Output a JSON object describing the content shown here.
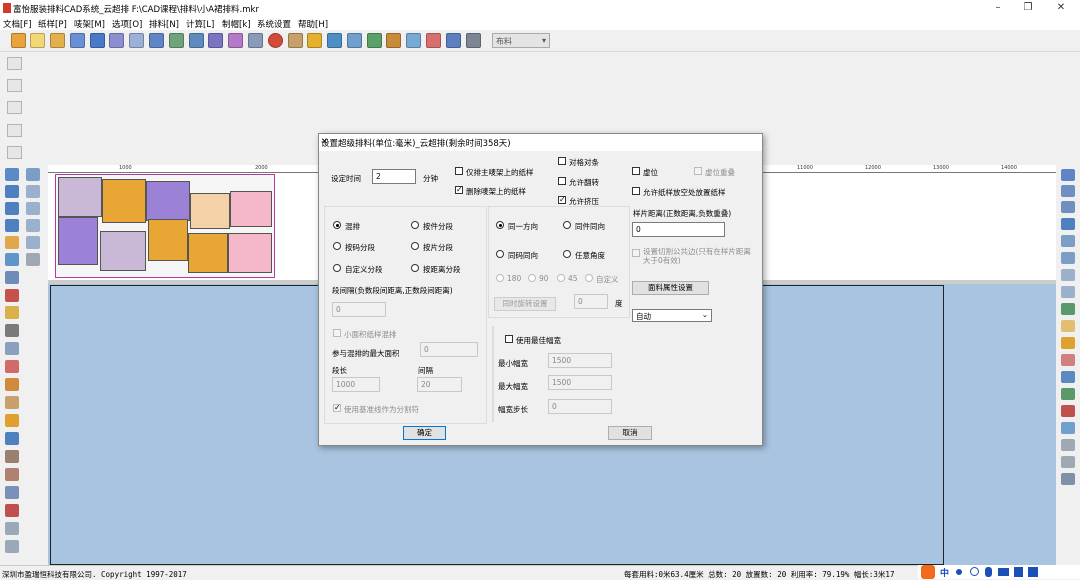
{
  "window": {
    "title": "富怡服装排料CAD系统_云超排 F:\\CAD课程\\排料\\小A裙排料.mkr"
  },
  "menu": [
    "文档[F]",
    "纸样[P]",
    "唛架[M]",
    "选项[O]",
    "排料[N]",
    "计算[L]",
    "制帽[k]",
    "系统设置",
    "帮助[H]"
  ],
  "toolbar": {
    "dropdown": "布料"
  },
  "ruler": [
    "1000",
    "2000",
    "11000",
    "12000",
    "13000",
    "14000"
  ],
  "dialog": {
    "title": "设置超级排料(单位:毫米)_云超排(剩余时间358天)",
    "set_time_label": "设定时间",
    "set_time_value": "2",
    "minute_label": "分钟",
    "opts": {
      "only_main_frame": "仅排主唛架上的纸样",
      "delete_frame": "删除唛架上的纸样",
      "strict_align": "对格对条",
      "allow_flip": "允许翻转",
      "allow_overlap": "允许挤压",
      "virtual": "虚位",
      "virtual_overlap": "虚位重叠",
      "allow_other_pos": "允许纸样放空处放置纸样"
    },
    "piece_dist_label": "样片距离(正数距离,负数重叠)",
    "piece_dist_value": "0",
    "cut_common_edge": "设置切割公共边(只有在样片距离大于0有效)",
    "mode": {
      "mix": "混排",
      "by_piece": "按件分段",
      "by_size": "按码分段",
      "by_slice": "按片分段",
      "custom": "自定义分段",
      "by_dist": "按距离分段"
    },
    "seg_gap_label": "段间隔(负数段间距离,正数段间距离)",
    "seg_gap_value": "0",
    "small_area_mix": "小面积纸样混排",
    "max_area_label": "参与混排的最大面积",
    "max_area_value": "0",
    "seg_length_label": "段长",
    "seg_length_value": "1000",
    "seg_gap2_label": "间隔",
    "seg_gap2_value": "20",
    "baseline_split": "使用基准线作为分割符",
    "direction": {
      "same": "同一方向",
      "per_piece": "同件同向",
      "per_size": "同码同向",
      "any": "任意角度"
    },
    "angles": [
      "180",
      "90",
      "45",
      "自定义"
    ],
    "rotate_btn": "同时旋转设置",
    "degree_value": "0",
    "degree_label": "度",
    "fabric_btn": "面料属性设置",
    "auto_select": "自动",
    "use_best_width": "使用最佳幅宽",
    "min_width_label": "最小幅宽",
    "min_width_value": "1500",
    "max_width_label": "最大幅宽",
    "max_width_value": "1500",
    "width_step_label": "幅宽步长",
    "width_step_value": "0",
    "ok": "确定",
    "cancel": "取消"
  },
  "status": {
    "left": "深圳市盈瑞恒科技有限公司. Copyright 1997-2017",
    "right": "每套用料:0米63.4厘米 总数: 20 放置数: 20 利用率: 79.19% 幅长:3米17"
  },
  "ime": {
    "lang": "中"
  }
}
